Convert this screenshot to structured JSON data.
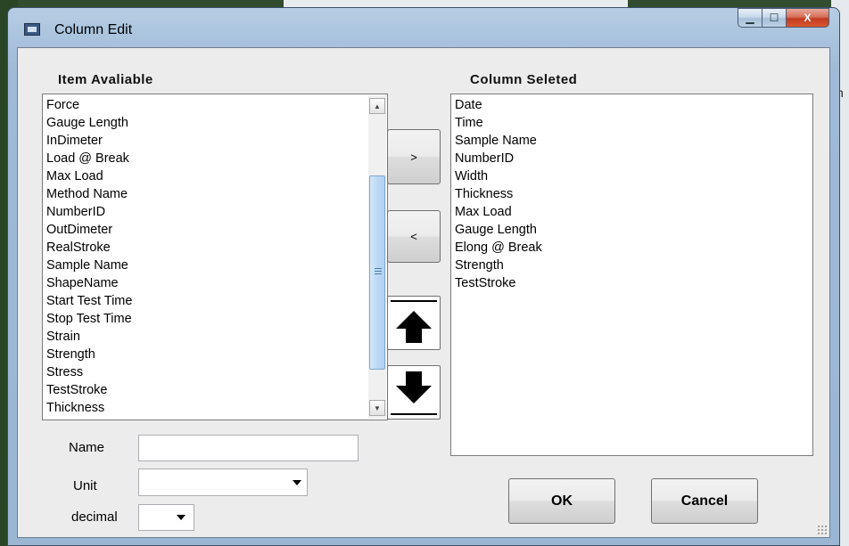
{
  "window": {
    "title": "Column Edit"
  },
  "caption": {
    "minimize": "▁",
    "maximize": "☐",
    "close": "X"
  },
  "background": {
    "edge_char": "h"
  },
  "available": {
    "label": "Item Avaliable",
    "items": [
      "Force",
      "Gauge Length",
      "InDimeter",
      "Load @ Break",
      "Max Load",
      "Method Name",
      "NumberID",
      "OutDimeter",
      "RealStroke",
      "Sample Name",
      "ShapeName",
      "Start Test Time",
      "Stop Test Time",
      "Strain",
      "Strength",
      "Stress",
      "TestStroke",
      "Thickness"
    ]
  },
  "selected": {
    "label": "Column Seleted",
    "items": [
      "Date",
      "Time",
      "Sample Name",
      "NumberID",
      "Width",
      "Thickness",
      "Max Load",
      "Gauge Length",
      "Elong @ Break",
      "Strength",
      "TestStroke"
    ]
  },
  "buttons": {
    "add": ">",
    "remove": "<",
    "ok": "OK",
    "cancel": "Cancel"
  },
  "fields": {
    "name_label": "Name",
    "name_value": "",
    "unit_label": "Unit",
    "unit_value": "",
    "decimal_label": "decimal",
    "decimal_value": ""
  },
  "icons": {
    "up": "arrow-up-icon",
    "down": "arrow-down-icon",
    "window": "window-icon"
  }
}
